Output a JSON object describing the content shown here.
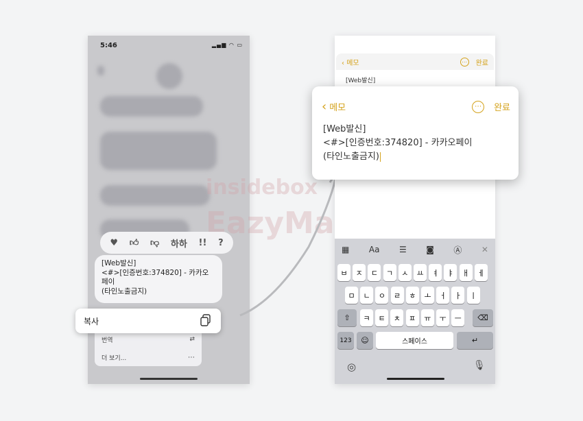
{
  "left_phone": {
    "status_time": "5:46",
    "reactions": [
      "heart-icon",
      "thumbs-up-icon",
      "thumbs-down-icon",
      "하하",
      "!!",
      "?"
    ],
    "message_lines": [
      "[Web발신]",
      "<#>[인증번호:374820] - 카카오",
      "페이",
      "(타인노출금지)"
    ],
    "copy_label": "복사",
    "more_items": [
      {
        "label": "번역",
        "icon": "translate-icon"
      },
      {
        "label": "더 보기...",
        "icon": "more-icon"
      }
    ]
  },
  "right_phone": {
    "back_label": "메모",
    "done_label": "완료",
    "small_note_text": "[Web발신]",
    "keyboard": {
      "row1": [
        "ㅂ",
        "ㅈ",
        "ㄷ",
        "ㄱ",
        "ㅅ",
        "ㅛ",
        "ㅕ",
        "ㅑ",
        "ㅐ",
        "ㅔ"
      ],
      "row2": [
        "ㅁ",
        "ㄴ",
        "ㅇ",
        "ㄹ",
        "ㅎ",
        "ㅗ",
        "ㅓ",
        "ㅏ",
        "ㅣ"
      ],
      "row3": [
        "ㅋ",
        "ㅌ",
        "ㅊ",
        "ㅍ",
        "ㅠ",
        "ㅜ",
        "ㅡ"
      ],
      "numbers_label": "123",
      "space_label": "스페이스",
      "toolbar_aa": "Aa"
    }
  },
  "zoom_card": {
    "back_label": "메모",
    "done_label": "완료",
    "lines": [
      "[Web발신]",
      "<#>[인증번호:374820] - 카카오페이",
      "(타인노출금지)"
    ]
  },
  "watermark": {
    "line1": "insidebox",
    "line2": "EazyManual"
  },
  "colors": {
    "accent": "#d4a21b",
    "page_bg": "#f3f4f5",
    "keyboard_bg": "#d2d3d8"
  }
}
